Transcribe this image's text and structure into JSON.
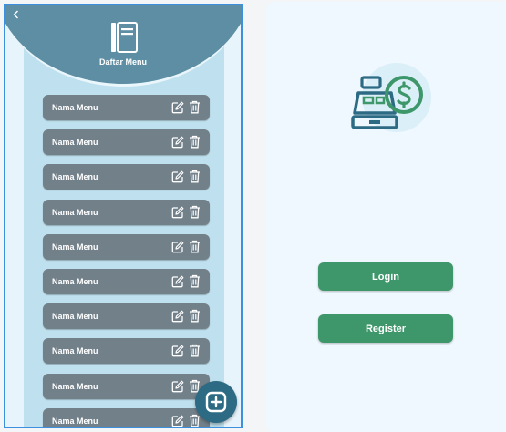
{
  "menu_screen": {
    "back_icon": "chevron-left-icon",
    "header_icon": "book-icon",
    "title": "Daftar Menu",
    "items": [
      {
        "label": "Nama Menu"
      },
      {
        "label": "Nama Menu"
      },
      {
        "label": "Nama Menu"
      },
      {
        "label": "Nama Menu"
      },
      {
        "label": "Nama Menu"
      },
      {
        "label": "Nama Menu"
      },
      {
        "label": "Nama Menu"
      },
      {
        "label": "Nama Menu"
      },
      {
        "label": "Nama Menu"
      },
      {
        "label": "Nama Menu"
      }
    ],
    "item_icons": [
      "edit-icon",
      "trash-icon"
    ],
    "fab_icon": "add-square-icon"
  },
  "auth_screen": {
    "logo_icon": "cash-register-icon",
    "login_label": "Login",
    "register_label": "Register"
  },
  "colors": {
    "frame_border": "#3d8fe0",
    "header": "#5d8ea3",
    "menu_item": "#72808a",
    "fab": "#2d6a83",
    "button_green": "#3e976a",
    "logo_dark": "#2d6a83",
    "logo_green": "#3e976a",
    "right_bg": "#eef8fe"
  }
}
